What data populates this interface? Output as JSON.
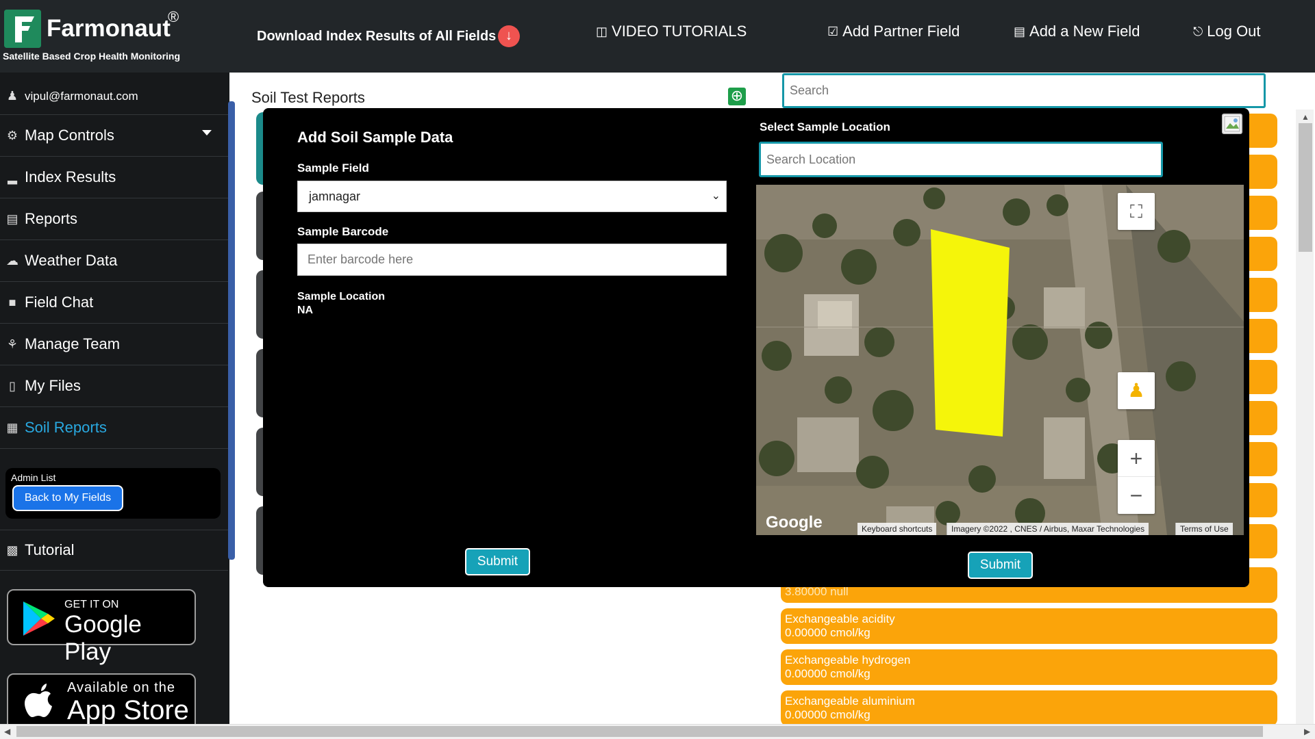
{
  "header": {
    "brand": "Farmonaut",
    "registered": "®",
    "tagline": "Satellite Based Crop Health Monitoring",
    "download_label": "Download Index Results of All Fields",
    "links": [
      {
        "label": "VIDEO TUTORIALS",
        "icon": "video-icon"
      },
      {
        "label": "Add Partner Field",
        "icon": "lock-icon"
      },
      {
        "label": "Add a New Field",
        "icon": "map-icon"
      },
      {
        "label": "Log Out",
        "icon": "logout-icon"
      }
    ]
  },
  "sidebar": {
    "email": "vipul@farmonaut.com",
    "items": [
      {
        "label": "Map Controls",
        "icon": "gear-icon"
      },
      {
        "label": "Index Results",
        "icon": "chart-icon"
      },
      {
        "label": "Reports",
        "icon": "document-icon"
      },
      {
        "label": "Weather Data",
        "icon": "cloud-icon"
      },
      {
        "label": "Field Chat",
        "icon": "chat-icon"
      },
      {
        "label": "Manage Team",
        "icon": "team-icon"
      },
      {
        "label": "My Files",
        "icon": "file-icon"
      },
      {
        "label": "Soil Reports",
        "icon": "flask-icon",
        "active": true
      }
    ],
    "admin_title": "Admin List",
    "back_button": "Back to My Fields",
    "tutorial": "Tutorial",
    "google_play": {
      "small": "GET IT ON",
      "big": "Google Play"
    },
    "app_store": {
      "small": "Available on the",
      "big": "App Store"
    }
  },
  "main": {
    "title": "Soil Test Reports",
    "search_placeholder": "Search",
    "cards": [
      {
        "label": "3.80000 null"
      },
      {
        "label": "Exchangeable acidity",
        "value": "0.00000 cmol/kg"
      },
      {
        "label": "Exchangeable hydrogen",
        "value": "0.00000 cmol/kg"
      },
      {
        "label": "Exchangeable aluminium",
        "value": "0.00000 cmol/kg"
      }
    ]
  },
  "modal": {
    "title": "Add Soil Sample Data",
    "field_label": "Sample Field",
    "field_value": "jamnagar",
    "barcode_label": "Sample Barcode",
    "barcode_placeholder": "Enter barcode here",
    "location_label": "Sample Location",
    "location_value": "NA",
    "submit": "Submit",
    "select_location_title": "Select Sample Location",
    "location_search_placeholder": "Search Location",
    "map": {
      "google": "Google",
      "keyboard_shortcuts": "Keyboard shortcuts",
      "imagery": "Imagery ©2022 , CNES / Airbus, Maxar Technologies",
      "terms": "Terms of Use",
      "polygon_color": "#f5f50a"
    },
    "map_submit": "Submit"
  },
  "colors": {
    "header_bg": "#222629",
    "sidebar_bg": "#17191b",
    "accent_teal": "#16a2b8",
    "card_orange": "#fba40a",
    "active_blue": "#29a9e1"
  }
}
